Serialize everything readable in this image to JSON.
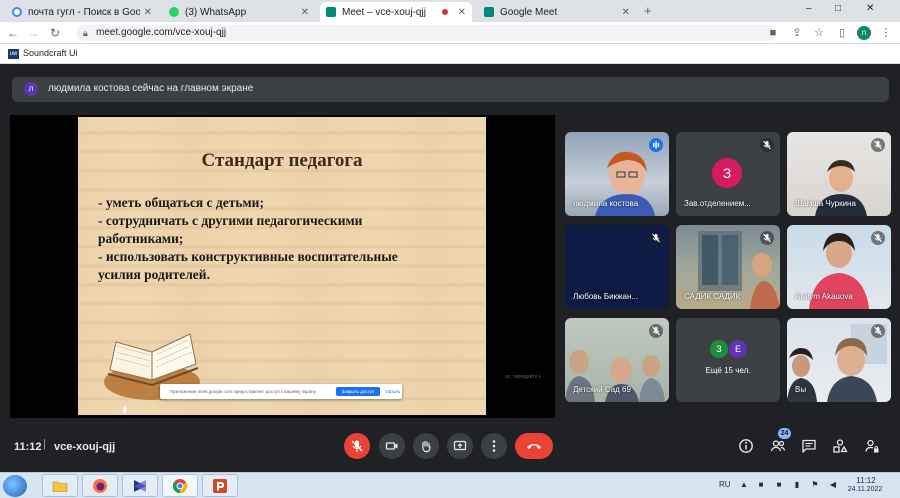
{
  "browser": {
    "tabs": [
      {
        "title": "почта гугл - Поиск в Google",
        "icon": "google-icon",
        "color": "#4285f4"
      },
      {
        "title": "(3) WhatsApp",
        "icon": "whatsapp-icon",
        "color": "#25d366"
      },
      {
        "title": "Meet – vce-xouj-qjj",
        "icon": "meet-icon",
        "color": "#00897b",
        "active": true
      },
      {
        "title": "Google Meet",
        "icon": "meet-icon",
        "color": "#00897b"
      }
    ],
    "new_tab": "+",
    "window_controls": [
      "–",
      "□",
      "✕"
    ],
    "url": "meet.google.com/vce-xouj-qjj",
    "profile_initial": "n",
    "bookmark": {
      "icon_text": "uw",
      "label": "Soundcraft Ui"
    }
  },
  "meet": {
    "banner": {
      "avatar": "л",
      "text": "людмила костова сейчас на главном экране"
    },
    "slide": {
      "title": "Стандарт педагога",
      "bullets": [
        "- уметь общаться с детьми;",
        " - сотрудничать с другими педагогическими",
        "работниками;",
        "- использовать конструктивные воспитательные",
        "усилия родителей."
      ],
      "share_message": "Приложение meet.google.com предоставляет доступ к вашему экрану.",
      "stop_button": "Закрыть доступ",
      "hide_link": "Скрыть",
      "ghost_text": "ас, передайте к"
    },
    "participants": [
      {
        "name": "людмила костова",
        "type": "video",
        "speaking": true
      },
      {
        "name": "Зав.отделением...",
        "type": "avatar",
        "initial": "З",
        "color": "#d81b60"
      },
      {
        "name": "Шамша Чуркина",
        "type": "video"
      },
      {
        "name": "Любовь Бикжан...",
        "type": "blank"
      },
      {
        "name": "САДИК САДИК",
        "type": "video"
      },
      {
        "name": "Araiym Akauova",
        "type": "video"
      },
      {
        "name": "Детский Сад 69",
        "type": "video"
      },
      {
        "name": "Ещё 15 чел.",
        "type": "more",
        "initials": [
          "З",
          "Е"
        ],
        "colors": [
          "#1e8e3e",
          "#5e35b1"
        ]
      },
      {
        "name": "Вы",
        "type": "video"
      }
    ],
    "bottom": {
      "time": "11:12",
      "separator": "|",
      "code": "vce-xouj-qjj",
      "people_count": "24"
    }
  },
  "taskbar": {
    "lang": "RU",
    "time": "11:12",
    "date": "24.11.2022"
  }
}
